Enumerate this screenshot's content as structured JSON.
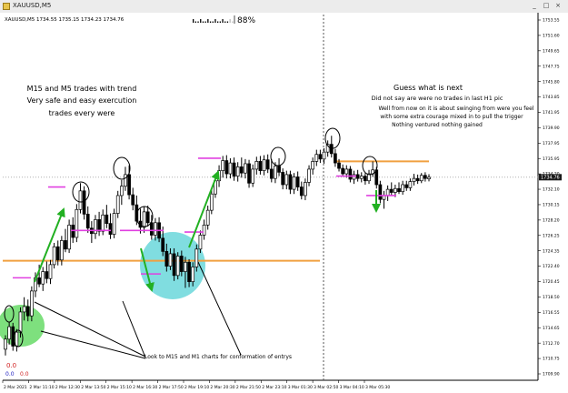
{
  "window": {
    "title": "XAUUSD,M5",
    "buttons": {
      "minimize": "_",
      "maximize": "□",
      "close": "×"
    }
  },
  "chart_data": {
    "type": "candlestick",
    "symbol_header": "XAUUSD,M5  1734.55 1735.15 1734.23 1734.76",
    "quote": {
      "open": 1734.55,
      "high": 1735.15,
      "low": 1734.23,
      "close": 1734.76
    },
    "current_price_label": "1734.76",
    "ylim": [
      1708.6,
      1755.6
    ],
    "y_ticks": [
      "1753.55",
      "1751.60",
      "1749.65",
      "1747.75",
      "1745.80",
      "1743.85",
      "1741.95",
      "1739.90",
      "1737.95",
      "1735.95",
      "1734.20",
      "1732.10",
      "1730.15",
      "1728.20",
      "1726.25",
      "1724.35",
      "1722.40",
      "1720.45",
      "1718.50",
      "1716.55",
      "1714.65",
      "1712.70",
      "1710.75",
      "1709.90"
    ],
    "x_ticks": [
      "2 Mar 2021",
      "2 Mar 11:10",
      "2 Mar 12:30",
      "2 Mar 13:50",
      "2 Mar 15:10",
      "2 Mar 16:30",
      "2 Mar 17:50",
      "2 Mar 19:10",
      "2 Mar 20:30",
      "2 Mar 21:50",
      "2 Mar 23:10",
      "3 Mar 01:30",
      "3 Mar 02:50",
      "3 Mar 04:10",
      "3 Mar 05:30"
    ],
    "progress_label": "88%",
    "progress_value": 0.88,
    "bottom_left_values": [
      "0.0",
      "0.0",
      "0.0"
    ],
    "candles": [
      [
        1712.6,
        1714.4,
        1711.8,
        1713.9
      ],
      [
        1713.9,
        1716.1,
        1713.2,
        1715.5
      ],
      [
        1715.5,
        1716.0,
        1712.4,
        1713.0
      ],
      [
        1713.0,
        1715.2,
        1712.3,
        1714.8
      ],
      [
        1714.8,
        1718.0,
        1714.1,
        1717.4
      ],
      [
        1717.4,
        1719.3,
        1716.3,
        1718.1
      ],
      [
        1718.1,
        1719.0,
        1716.2,
        1716.9
      ],
      [
        1716.9,
        1720.7,
        1716.2,
        1720.1
      ],
      [
        1720.1,
        1722.5,
        1719.3,
        1721.8
      ],
      [
        1721.8,
        1723.5,
        1720.6,
        1721.0
      ],
      [
        1721.0,
        1723.2,
        1720.1,
        1722.6
      ],
      [
        1722.6,
        1723.9,
        1721.1,
        1721.7
      ],
      [
        1721.7,
        1724.1,
        1721.0,
        1723.5
      ],
      [
        1723.5,
        1726.3,
        1723.0,
        1725.8
      ],
      [
        1725.8,
        1726.6,
        1723.4,
        1724.1
      ],
      [
        1724.1,
        1727.2,
        1723.4,
        1726.6
      ],
      [
        1726.6,
        1728.1,
        1725.1,
        1725.5
      ],
      [
        1725.5,
        1729.3,
        1725.0,
        1728.6
      ],
      [
        1728.6,
        1729.6,
        1726.3,
        1727.0
      ],
      [
        1727.0,
        1731.3,
        1726.4,
        1730.6
      ],
      [
        1730.6,
        1734.0,
        1730.1,
        1733.0
      ],
      [
        1733.0,
        1733.6,
        1729.3,
        1730.0
      ],
      [
        1730.0,
        1731.0,
        1727.6,
        1728.2
      ],
      [
        1728.2,
        1729.1,
        1726.3,
        1727.5
      ],
      [
        1727.5,
        1729.9,
        1726.8,
        1729.3
      ],
      [
        1729.3,
        1730.3,
        1727.2,
        1727.8
      ],
      [
        1727.8,
        1730.6,
        1727.3,
        1729.9
      ],
      [
        1729.9,
        1731.2,
        1728.2,
        1728.8
      ],
      [
        1728.8,
        1730.1,
        1726.8,
        1727.4
      ],
      [
        1727.4,
        1730.7,
        1726.9,
        1730.1
      ],
      [
        1730.1,
        1733.0,
        1729.5,
        1732.4
      ],
      [
        1732.4,
        1734.4,
        1731.2,
        1733.6
      ],
      [
        1733.6,
        1736.1,
        1733.0,
        1735.1
      ],
      [
        1735.1,
        1736.3,
        1731.9,
        1732.5
      ],
      [
        1732.5,
        1733.4,
        1730.5,
        1731.2
      ],
      [
        1731.2,
        1732.4,
        1728.6,
        1729.1
      ],
      [
        1729.1,
        1730.7,
        1727.5,
        1728.3
      ],
      [
        1728.3,
        1731.0,
        1727.6,
        1730.3
      ],
      [
        1730.3,
        1731.1,
        1728.4,
        1728.9
      ],
      [
        1728.9,
        1729.9,
        1726.7,
        1727.3
      ],
      [
        1727.3,
        1729.5,
        1726.6,
        1728.9
      ],
      [
        1728.9,
        1729.6,
        1726.4,
        1726.9
      ],
      [
        1726.9,
        1728.4,
        1724.6,
        1725.2
      ],
      [
        1725.2,
        1726.2,
        1722.6,
        1723.3
      ],
      [
        1723.3,
        1725.6,
        1722.8,
        1724.9
      ],
      [
        1724.9,
        1725.6,
        1721.4,
        1722.1
      ],
      [
        1722.1,
        1725.1,
        1721.6,
        1724.6
      ],
      [
        1724.6,
        1725.3,
        1722.0,
        1722.6
      ],
      [
        1722.6,
        1724.5,
        1720.5,
        1723.8
      ],
      [
        1723.8,
        1724.2,
        1720.6,
        1721.3
      ],
      [
        1721.3,
        1723.8,
        1720.7,
        1723.2
      ],
      [
        1723.2,
        1726.1,
        1722.6,
        1725.5
      ],
      [
        1725.5,
        1727.9,
        1725.0,
        1727.3
      ],
      [
        1727.3,
        1729.3,
        1726.7,
        1728.6
      ],
      [
        1728.6,
        1731.1,
        1728.0,
        1730.5
      ],
      [
        1730.5,
        1733.1,
        1730.0,
        1732.6
      ],
      [
        1732.6,
        1734.9,
        1732.1,
        1734.3
      ],
      [
        1734.3,
        1736.3,
        1733.5,
        1735.6
      ],
      [
        1735.6,
        1737.5,
        1734.7,
        1736.9
      ],
      [
        1736.9,
        1737.6,
        1734.6,
        1735.2
      ],
      [
        1735.2,
        1737.2,
        1734.6,
        1736.6
      ],
      [
        1736.6,
        1737.3,
        1734.3,
        1734.9
      ],
      [
        1734.9,
        1736.7,
        1734.2,
        1736.1
      ],
      [
        1736.1,
        1737.3,
        1734.7,
        1735.3
      ],
      [
        1735.3,
        1737.1,
        1734.6,
        1736.5
      ],
      [
        1736.5,
        1737.0,
        1733.4,
        1734.0
      ],
      [
        1734.0,
        1736.4,
        1733.5,
        1735.8
      ],
      [
        1735.8,
        1737.4,
        1735.1,
        1736.8
      ],
      [
        1736.8,
        1737.5,
        1735.1,
        1735.6
      ],
      [
        1735.6,
        1737.6,
        1735.0,
        1737.0
      ],
      [
        1737.0,
        1737.7,
        1735.3,
        1735.8
      ],
      [
        1735.8,
        1737.1,
        1734.1,
        1734.6
      ],
      [
        1734.6,
        1736.7,
        1734.0,
        1736.2
      ],
      [
        1736.2,
        1737.2,
        1734.9,
        1735.4
      ],
      [
        1735.4,
        1735.9,
        1733.2,
        1733.8
      ],
      [
        1733.8,
        1735.6,
        1733.2,
        1735.1
      ],
      [
        1735.1,
        1735.6,
        1732.6,
        1733.2
      ],
      [
        1733.2,
        1735.3,
        1732.6,
        1734.8
      ],
      [
        1734.8,
        1735.5,
        1733.0,
        1733.5
      ],
      [
        1733.5,
        1734.2,
        1731.9,
        1732.4
      ],
      [
        1732.4,
        1734.6,
        1731.8,
        1734.1
      ],
      [
        1734.1,
        1736.3,
        1733.6,
        1735.8
      ],
      [
        1735.8,
        1737.3,
        1735.1,
        1736.8
      ],
      [
        1736.8,
        1738.3,
        1736.2,
        1737.7
      ],
      [
        1737.7,
        1738.3,
        1736.6,
        1737.1
      ],
      [
        1737.1,
        1738.5,
        1736.5,
        1738.0
      ],
      [
        1738.0,
        1739.5,
        1737.4,
        1739.0
      ],
      [
        1739.0,
        1740.1,
        1737.3,
        1737.8
      ],
      [
        1737.8,
        1738.4,
        1736.1,
        1736.6
      ],
      [
        1736.6,
        1737.1,
        1735.5,
        1735.9
      ],
      [
        1735.9,
        1736.4,
        1734.8,
        1735.2
      ],
      [
        1735.2,
        1736.3,
        1734.7,
        1735.8
      ],
      [
        1735.8,
        1736.2,
        1734.1,
        1734.5
      ],
      [
        1734.5,
        1735.6,
        1733.9,
        1735.1
      ],
      [
        1735.1,
        1735.7,
        1734.2,
        1734.6
      ],
      [
        1734.6,
        1735.4,
        1734.1,
        1734.9
      ],
      [
        1734.9,
        1735.3,
        1733.8,
        1734.3
      ],
      [
        1734.3,
        1735.7,
        1733.9,
        1735.2
      ],
      [
        1735.2,
        1736.8,
        1734.8,
        1735.7
      ],
      [
        1735.7,
        1736.1,
        1733.3,
        1733.8
      ],
      [
        1733.8,
        1734.3,
        1731.4,
        1731.9
      ],
      [
        1731.9,
        1733.0,
        1730.7,
        1732.4
      ],
      [
        1732.4,
        1733.7,
        1731.7,
        1733.2
      ],
      [
        1733.2,
        1734.1,
        1732.4,
        1732.8
      ],
      [
        1732.8,
        1733.8,
        1732.2,
        1733.3
      ],
      [
        1733.3,
        1734.1,
        1732.6,
        1732.9
      ],
      [
        1732.9,
        1734.3,
        1732.5,
        1733.8
      ],
      [
        1733.8,
        1734.3,
        1733.0,
        1733.4
      ],
      [
        1733.4,
        1734.6,
        1733.0,
        1734.2
      ],
      [
        1734.2,
        1735.2,
        1733.7,
        1734.6
      ],
      [
        1734.6,
        1735.1,
        1733.9,
        1734.3
      ],
      [
        1734.3,
        1735.3,
        1734.0,
        1735.0
      ],
      [
        1735.0,
        1735.4,
        1734.2,
        1734.6
      ],
      [
        1734.55,
        1735.15,
        1734.23,
        1734.76
      ]
    ],
    "horizontal_lines": [
      {
        "name": "support-line",
        "y": 1724.0,
        "color": "#f0a040"
      },
      {
        "name": "resistance-line",
        "y": 1736.8,
        "color": "#f0a040"
      }
    ],
    "markers": [
      {
        "name": "magenta-marker",
        "y": 1721.8,
        "color": "#e040e0"
      },
      {
        "name": "magenta-marker",
        "y": 1733.5,
        "color": "#e040e0"
      },
      {
        "name": "magenta-marker",
        "y": 1727.9,
        "color": "#e040e0"
      },
      {
        "name": "magenta-marker",
        "y": 1727.9,
        "color": "#e040e0"
      },
      {
        "name": "magenta-marker",
        "y": 1722.3,
        "color": "#e040e0"
      },
      {
        "name": "magenta-marker",
        "y": 1727.7,
        "color": "#e040e0"
      },
      {
        "name": "magenta-marker",
        "y": 1737.2,
        "color": "#e040e0"
      },
      {
        "name": "magenta-marker",
        "y": 1734.9,
        "color": "#e040e0"
      },
      {
        "name": "magenta-marker",
        "y": 1732.4,
        "color": "#e040e0"
      }
    ],
    "annotations": [
      {
        "name": "note-m15-m5",
        "text": "M15 and M5 trades with trend"
      },
      {
        "name": "note-safe",
        "text": "Very safe and easy exercution"
      },
      {
        "name": "note-trades",
        "text": "trades every were"
      },
      {
        "name": "note-guess",
        "text": "Guess what is next"
      },
      {
        "name": "note-no-trades",
        "text": "Did not say are were no trades in last H1 pic"
      },
      {
        "name": "note-swinging",
        "text": "Well from now on it is about swinging from were you feel"
      },
      {
        "name": "note-courage",
        "text": "with some extra courage mixed in to pull the trigger"
      },
      {
        "name": "note-nothing",
        "text": "Nothing ventured nothing gained"
      },
      {
        "name": "note-look",
        "text": "Look to M15 and M1 charts for conformation of entrys"
      }
    ],
    "colors": {
      "background": "#ffffff",
      "candle": "#000000",
      "orange": "#f0a040",
      "magenta": "#e040e0",
      "arrow": "#22b022",
      "highlight_green": "#7ee07e",
      "highlight_cyan": "#80dde0",
      "price_label_bg": "#1a1a1a",
      "red": "#d02020",
      "blue": "#2020c0"
    },
    "grid": false
  }
}
